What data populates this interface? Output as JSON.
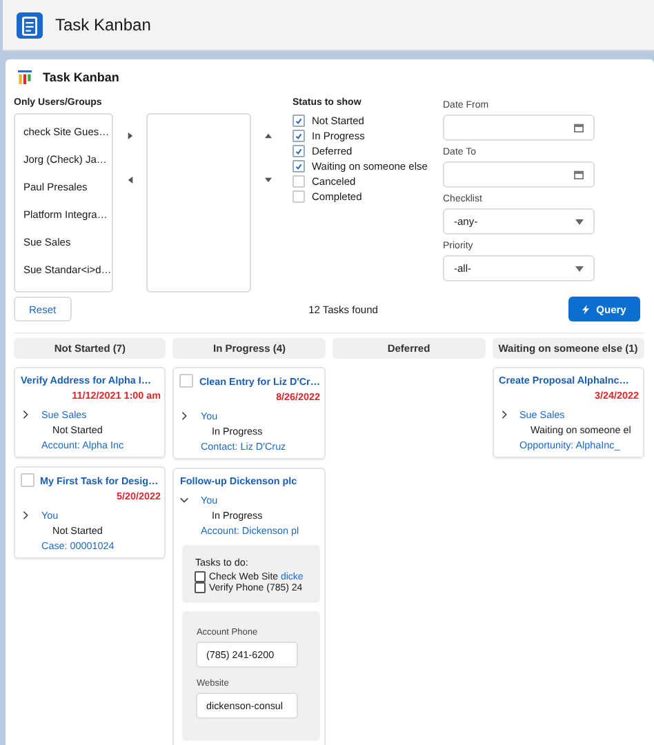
{
  "header": {
    "title": "Task Kanban"
  },
  "card_title": "Task Kanban",
  "users": {
    "label": "Only Users/Groups",
    "available": [
      "check Site Gues…",
      "Jorg (Check) Ja…",
      "Paul Presales",
      "Platform Integra…",
      "Sue Sales",
      "Sue Standar<i>d…"
    ]
  },
  "status": {
    "label": "Status to show",
    "options": [
      {
        "label": "Not Started",
        "checked": true
      },
      {
        "label": "In Progress",
        "checked": true
      },
      {
        "label": "Deferred",
        "checked": true
      },
      {
        "label": "Waiting on someone else",
        "checked": true
      },
      {
        "label": "Canceled",
        "checked": false
      },
      {
        "label": "Completed",
        "checked": false
      }
    ]
  },
  "filters": [
    {
      "kind": "date",
      "label": "Date From"
    },
    {
      "kind": "date",
      "label": "Date To"
    },
    {
      "kind": "select",
      "label": "Checklist",
      "value": "-any-"
    },
    {
      "kind": "select",
      "label": "Priority",
      "value": "-all-"
    }
  ],
  "reset_button": "Reset",
  "found": "12 Tasks found",
  "query_button": "Query",
  "columns": [
    {
      "title": "Not Started (7)",
      "cards": [
        {
          "title": "Verify Address for Alpha I…",
          "due": "11/12/2021 1:00 am",
          "expanded": false,
          "owner": "Sue Sales",
          "status": "Not Started",
          "related": "Account: Alpha Inc"
        },
        {
          "title": "My First Task for Desig…",
          "due": "5/20/2022",
          "checked": false,
          "expanded": false,
          "owner": "You",
          "status": "Not Started",
          "related": "Case: 00001024"
        }
      ]
    },
    {
      "title": "In Progress (4)",
      "cards": [
        {
          "title": "Clean Entry for Liz D'Cr…",
          "due": "8/26/2022",
          "checked": false,
          "expanded": false,
          "owner": "You",
          "status": "In Progress",
          "related": "Contact: Liz D'Cruz"
        },
        {
          "title": "Follow-up Dickenson plc",
          "expanded": true,
          "owner": "You",
          "status": "In Progress",
          "related": "Account: Dickenson pl",
          "checklist": {
            "label": "Tasks to do:",
            "items": [
              {
                "text": "Check Web Site",
                "link": "dicke",
                "checked": false
              },
              {
                "text": "Verify Phone (785) 24",
                "checked": false
              }
            ]
          },
          "fields": [
            {
              "label": "Account Phone",
              "value": "(785) 241-6200"
            },
            {
              "label": "Website",
              "value": "dickenson-consul"
            }
          ]
        }
      ]
    },
    {
      "title": "Deferred"
    },
    {
      "title": "Waiting on someone else (1)",
      "cards": [
        {
          "title": "Create Proposal AlphaInc…",
          "due": "3/24/2022",
          "expanded": false,
          "owner": "Sue Sales",
          "status": "Waiting on someone el",
          "related": "Opportunity: AlphaInc_"
        }
      ]
    }
  ]
}
